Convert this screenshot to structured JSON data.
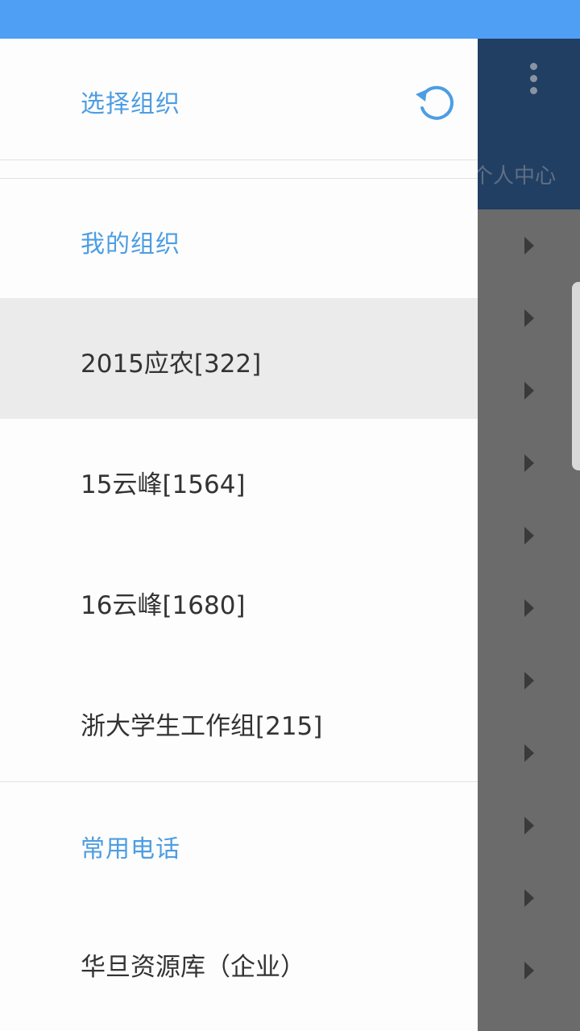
{
  "status_bar": {
    "color": "#4f9ff5"
  },
  "background_app": {
    "header_color": "#213f63",
    "tab_label": "个人中心",
    "menu_icon": "more-vertical-icon",
    "row_arrow_icon": "chevron-right-icon"
  },
  "drawer": {
    "title": "选择组织",
    "refresh_icon": "refresh-icon",
    "accent_color": "#4d9de3",
    "my_orgs_label": "我的组织",
    "orgs": [
      {
        "label": "2015应农[322]",
        "selected": true
      },
      {
        "label": "15云峰[1564]",
        "selected": false
      },
      {
        "label": "16云峰[1680]",
        "selected": false
      },
      {
        "label": "浙大学生工作组[215]",
        "selected": false
      }
    ],
    "phones_label": "常用电话",
    "phones": [
      {
        "label": "华旦资源库（企业）"
      }
    ]
  }
}
